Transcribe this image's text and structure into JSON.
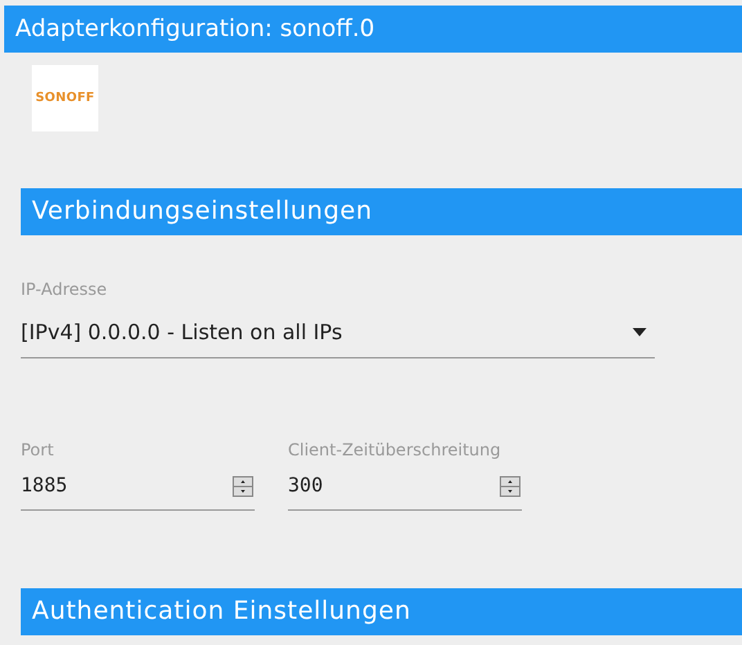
{
  "window": {
    "title": "Adapterkonfiguration: sonoff.0"
  },
  "logo": {
    "text": "SONOFF"
  },
  "sections": [
    {
      "title": "Verbindungseinstellungen"
    },
    {
      "title": "Authentication Einstellungen"
    }
  ],
  "ip_select": {
    "label": "IP-Adresse",
    "value": "[IPv4] 0.0.0.0 - Listen on all IPs"
  },
  "number_fields": [
    {
      "label": "Port",
      "value": "1885"
    },
    {
      "label": "Client-Zeitüberschreitung",
      "value": "300"
    }
  ]
}
